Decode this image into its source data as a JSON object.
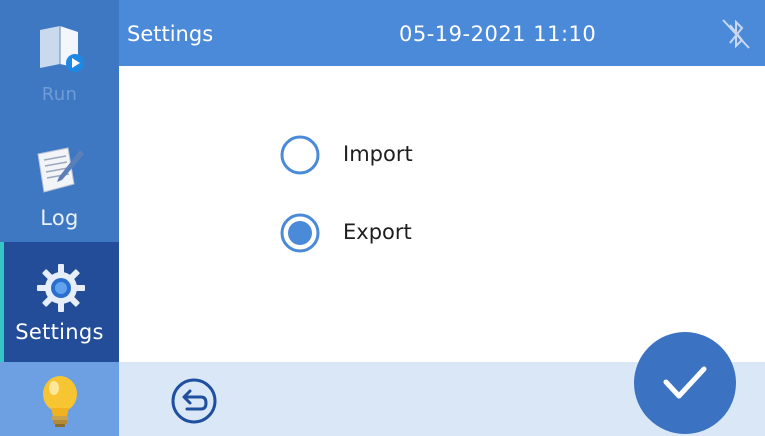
{
  "sidebar": {
    "items": [
      {
        "label": "Run",
        "icon": "book-play-icon",
        "state": "disabled"
      },
      {
        "label": "Log",
        "icon": "notepad-pen-icon",
        "state": "normal"
      },
      {
        "label": "Settings",
        "icon": "gear-icon",
        "state": "selected"
      },
      {
        "label": "",
        "icon": "lightbulb-icon",
        "state": "normal"
      }
    ]
  },
  "header": {
    "title": "Settings",
    "datetime": "05-19-2021 11:10",
    "status_icon": "bluetooth-icon"
  },
  "main": {
    "options": [
      {
        "label": "Import",
        "selected": false
      },
      {
        "label": "Export",
        "selected": true
      }
    ]
  },
  "footer": {
    "back_icon": "back-arrow-icon",
    "confirm_icon": "checkmark-icon"
  },
  "colors": {
    "sidebar": "#3f78c2",
    "sidebar_selected": "#234d99",
    "header": "#4a8ad8",
    "footer": "#d9e7f7",
    "accent": "#3b73c2",
    "radio": "#4a8ad8"
  }
}
